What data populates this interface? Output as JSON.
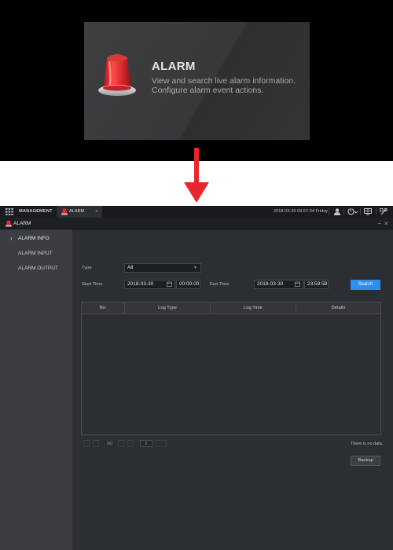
{
  "tile": {
    "title": "ALARM",
    "description_line1": "View and search live alarm information.",
    "description_line2": "Configure alarm event actions."
  },
  "tabbar": {
    "management_tab": "MANAGEMENT",
    "alarm_tab": "ALARM",
    "close_glyph": "×",
    "datetime": "2018-03-30 09:57:04 Friday",
    "icons": [
      "grid-icon",
      "user-icon",
      "logout-icon",
      "monitor-icon",
      "settings-icon"
    ]
  },
  "window": {
    "title": "ALARM",
    "minimize_glyph": "–",
    "close_glyph": "×"
  },
  "sidebar": {
    "items": [
      {
        "label": "ALARM INFO",
        "selected": true
      },
      {
        "label": "ALARM INPUT",
        "selected": false
      },
      {
        "label": "ALARM OUTPUT",
        "selected": false
      }
    ]
  },
  "form": {
    "type_label": "Type",
    "type_value": "All",
    "start_time_label": "Start Time",
    "start_date": "2018-03-30",
    "start_time": "00:00:00",
    "end_time_label": "End Time",
    "end_date": "2018-03-30",
    "end_time": "23:59:59",
    "search_button": "Search"
  },
  "table": {
    "columns": [
      "No.",
      "Log Type",
      "Log Time",
      "Details"
    ],
    "rows": []
  },
  "pager": {
    "page_status": "0/0",
    "page_input": "0"
  },
  "status": {
    "no_data": "There is no data."
  },
  "actions": {
    "backup_button": "Backup"
  },
  "colors": {
    "accent": "#2d8ef0",
    "alarm_red": "#e8262c",
    "background": "#2b2e33",
    "sidebar": "#3b3d42"
  }
}
